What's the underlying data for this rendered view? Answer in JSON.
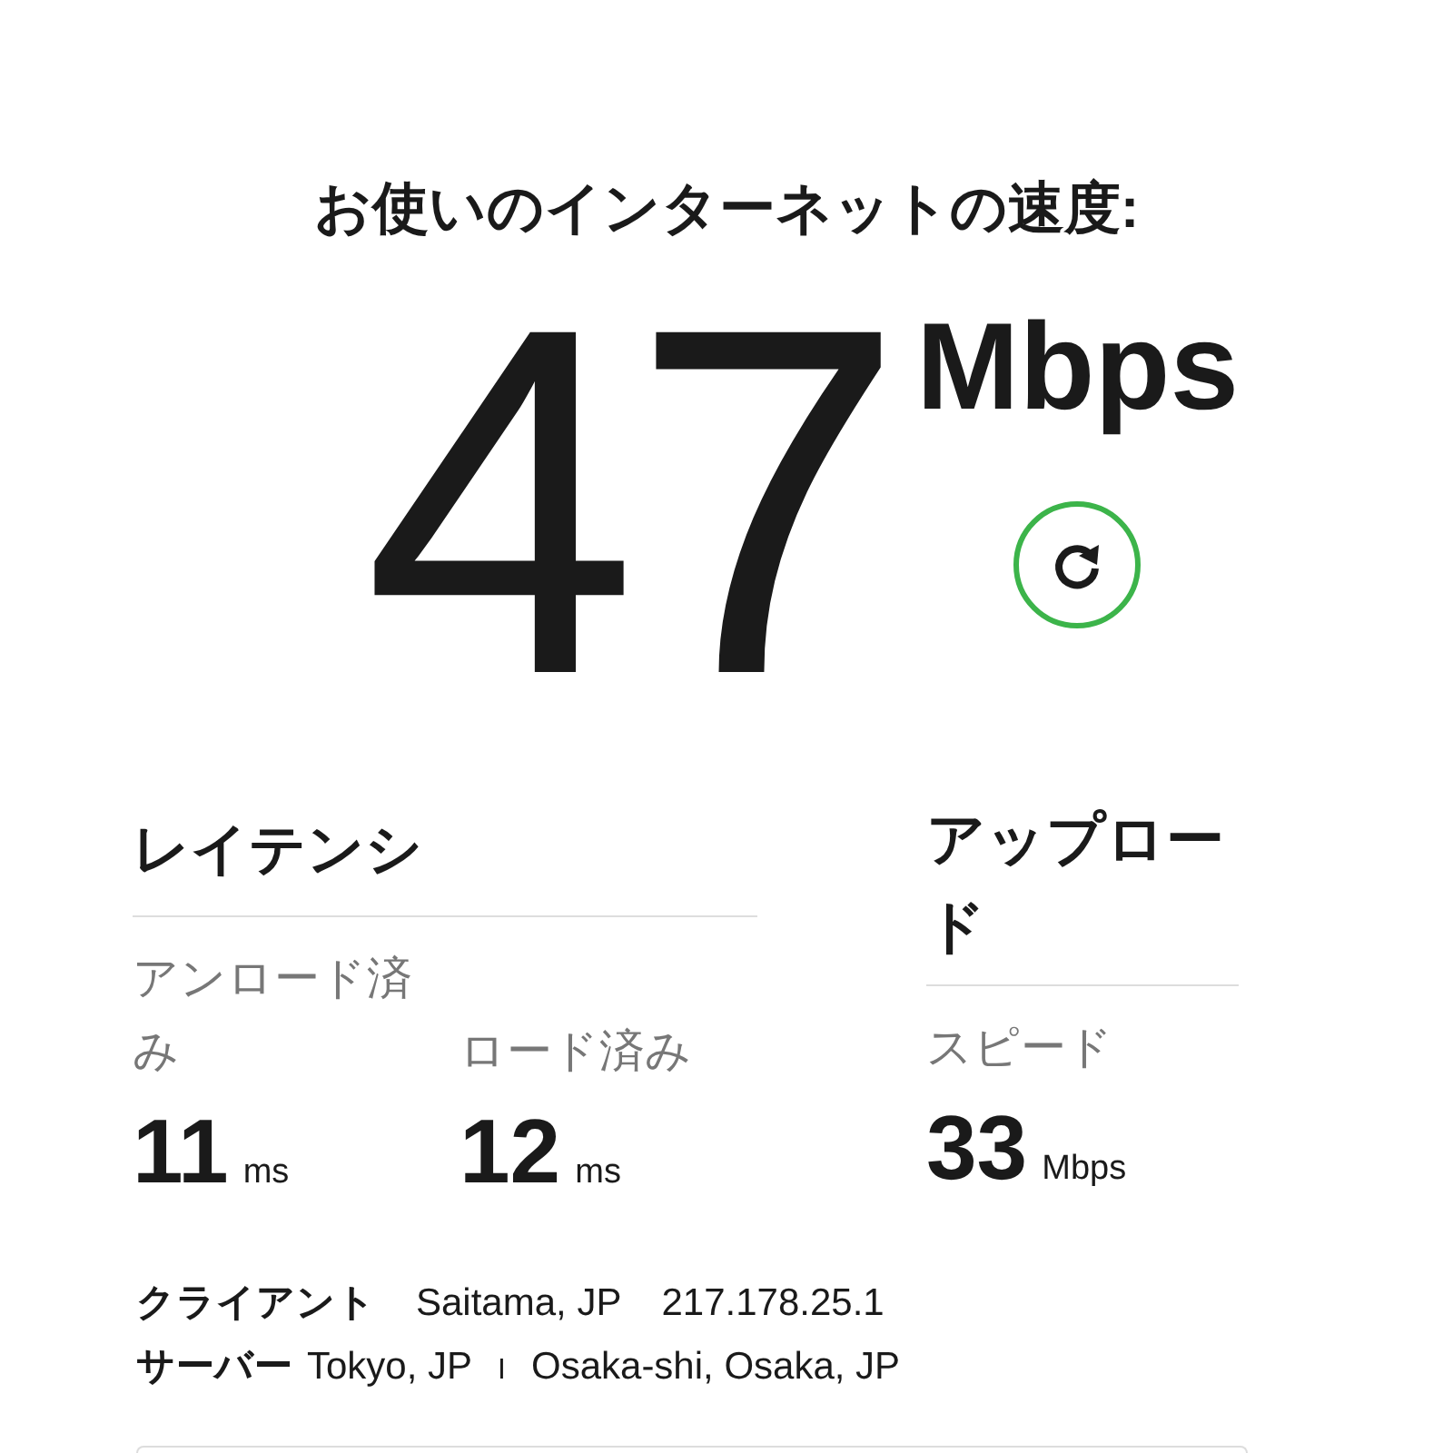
{
  "title": "お使いのインターネットの速度:",
  "download": {
    "value": "47",
    "unit": "Mbps"
  },
  "latency": {
    "heading": "レイテンシ",
    "items": [
      {
        "label": "アンロード済み",
        "value": "11",
        "unit": "ms"
      },
      {
        "label": "ロード済み",
        "value": "12",
        "unit": "ms"
      }
    ]
  },
  "upload": {
    "heading": "アップロード",
    "label": "スピード",
    "value": "33",
    "unit": "Mbps"
  },
  "client": {
    "label": "クライアント",
    "location": "Saitama, JP",
    "ip": "217.178.25.1"
  },
  "server": {
    "label": "サーバー",
    "locations": [
      "Tokyo, JP",
      "Osaka-shi, Osaka, JP"
    ],
    "separator": "I"
  }
}
